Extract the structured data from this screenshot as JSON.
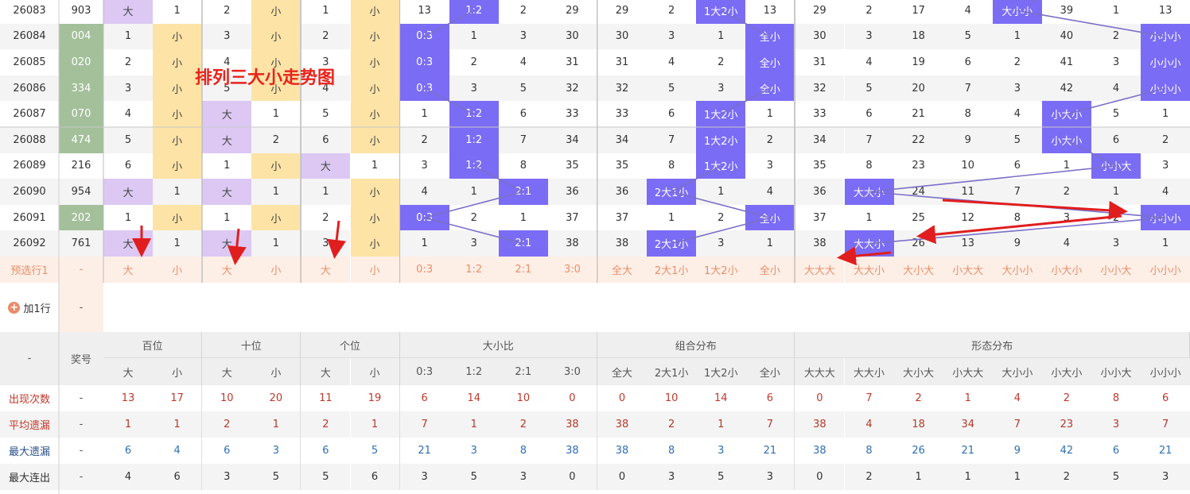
{
  "title_overlay": "排列三大小走势图",
  "header": {
    "blank_label": "-",
    "number_label": "奖号",
    "groups": [
      "百位",
      "十位",
      "个位",
      "大小比",
      "组合分布",
      "形态分布"
    ],
    "sub": [
      "大",
      "小",
      "大",
      "小",
      "大",
      "小",
      "0:3",
      "1:2",
      "2:1",
      "3:0",
      "全大",
      "2大1小",
      "1大2小",
      "全小",
      "大大大",
      "大大小",
      "大小大",
      "小大大",
      "大小小",
      "小大小",
      "小小大",
      "小小小"
    ]
  },
  "rows": [
    {
      "issue": "26083",
      "num": "903",
      "cells": [
        "大",
        "1",
        "2",
        "小",
        "1",
        "小",
        "13",
        "1:2",
        "2",
        "29",
        "29",
        "2",
        "1大2小",
        "13",
        "29",
        "2",
        "17",
        "4",
        "大小小",
        "39",
        "1",
        "13"
      ]
    },
    {
      "issue": "26084",
      "num": "004",
      "cells": [
        "1",
        "小",
        "3",
        "小",
        "2",
        "小",
        "0:3",
        "1",
        "3",
        "30",
        "30",
        "3",
        "1",
        "全小",
        "30",
        "3",
        "18",
        "5",
        "1",
        "40",
        "2",
        "小小小"
      ]
    },
    {
      "issue": "26085",
      "num": "020",
      "cells": [
        "2",
        "小",
        "4",
        "小",
        "3",
        "小",
        "0:3",
        "2",
        "4",
        "31",
        "31",
        "4",
        "2",
        "全小",
        "31",
        "4",
        "19",
        "6",
        "2",
        "41",
        "3",
        "小小小"
      ]
    },
    {
      "issue": "26086",
      "num": "334",
      "cells": [
        "3",
        "小",
        "5",
        "小",
        "4",
        "小",
        "0:3",
        "3",
        "5",
        "32",
        "32",
        "5",
        "3",
        "全小",
        "32",
        "5",
        "20",
        "7",
        "3",
        "42",
        "4",
        "小小小"
      ]
    },
    {
      "issue": "26087",
      "num": "070",
      "cells": [
        "4",
        "小",
        "大",
        "1",
        "5",
        "小",
        "1",
        "1:2",
        "6",
        "33",
        "33",
        "6",
        "1大2小",
        "1",
        "33",
        "6",
        "21",
        "8",
        "4",
        "小大小",
        "5",
        "1"
      ]
    },
    {
      "issue": "26088",
      "num": "474",
      "cells": [
        "5",
        "小",
        "大",
        "2",
        "6",
        "小",
        "2",
        "1:2",
        "7",
        "34",
        "34",
        "7",
        "1大2小",
        "2",
        "34",
        "7",
        "22",
        "9",
        "5",
        "小大小",
        "6",
        "2"
      ]
    },
    {
      "issue": "26089",
      "num": "216",
      "cells": [
        "6",
        "小",
        "1",
        "小",
        "大",
        "1",
        "3",
        "1:2",
        "8",
        "35",
        "35",
        "8",
        "1大2小",
        "3",
        "35",
        "8",
        "23",
        "10",
        "6",
        "1",
        "小小大",
        "3"
      ]
    },
    {
      "issue": "26090",
      "num": "954",
      "cells": [
        "大",
        "1",
        "大",
        "1",
        "1",
        "小",
        "4",
        "1",
        "2:1",
        "36",
        "36",
        "2大1小",
        "1",
        "4",
        "36",
        "大大小",
        "24",
        "11",
        "7",
        "2",
        "1",
        "4"
      ]
    },
    {
      "issue": "26091",
      "num": "202",
      "cells": [
        "1",
        "小",
        "1",
        "小",
        "2",
        "小",
        "0:3",
        "2",
        "1",
        "37",
        "37",
        "1",
        "2",
        "全小",
        "37",
        "1",
        "25",
        "12",
        "8",
        "3",
        "2",
        "小小小"
      ]
    },
    {
      "issue": "26092",
      "num": "761",
      "cells": [
        "大",
        "1",
        "大",
        "1",
        "3",
        "小",
        "1",
        "3",
        "2:1",
        "38",
        "38",
        "2大1小",
        "3",
        "1",
        "38",
        "大大小",
        "26",
        "13",
        "9",
        "4",
        "3",
        "1"
      ]
    }
  ],
  "preselect": {
    "label": "预选行1",
    "num": "-",
    "cells": [
      "大",
      "小",
      "大",
      "小",
      "大",
      "小",
      "0:3",
      "1:2",
      "2:1",
      "3:0",
      "全大",
      "2大1小",
      "1大2小",
      "全小",
      "大大大",
      "大大小",
      "大小大",
      "小大大",
      "大小小",
      "小大小",
      "小小大",
      "小小小"
    ]
  },
  "add_row": {
    "icon": "plus-circle-icon",
    "label": "加1行",
    "num": "-"
  },
  "stats": [
    {
      "label": "出现次数",
      "num": "-",
      "values": [
        "13",
        "17",
        "10",
        "20",
        "11",
        "19",
        "6",
        "14",
        "10",
        "0",
        "0",
        "10",
        "14",
        "6",
        "0",
        "7",
        "2",
        "1",
        "4",
        "2",
        "8",
        "6"
      ]
    },
    {
      "label": "平均遗漏",
      "num": "-",
      "values": [
        "1",
        "1",
        "2",
        "1",
        "2",
        "1",
        "7",
        "1",
        "2",
        "38",
        "38",
        "2",
        "1",
        "7",
        "38",
        "4",
        "18",
        "34",
        "7",
        "23",
        "3",
        "7"
      ]
    },
    {
      "label": "最大遗漏",
      "num": "-",
      "values": [
        "6",
        "4",
        "6",
        "3",
        "6",
        "5",
        "21",
        "3",
        "8",
        "38",
        "38",
        "8",
        "3",
        "21",
        "38",
        "8",
        "26",
        "21",
        "9",
        "42",
        "6",
        "21"
      ]
    },
    {
      "label": "最大连出",
      "num": "-",
      "values": [
        "4",
        "6",
        "3",
        "5",
        "5",
        "6",
        "3",
        "5",
        "3",
        "0",
        "0",
        "3",
        "5",
        "3",
        "0",
        "2",
        "1",
        "1",
        "1",
        "2",
        "5",
        "3"
      ]
    }
  ],
  "colors": {
    "green": "#a3c09a",
    "lavender": "#dcc8f3",
    "yellow": "#fde3a6",
    "purple": "#7b6cf5",
    "pre_bg": "#fdeee6",
    "pre_text": "#e8906a",
    "header_bg": "#efefef",
    "line": "#7a70c8",
    "arrow": "#e01e1e",
    "count_red": "#c0392b",
    "avg_red": "#b23a2b",
    "max_blue": "#2f6fb5",
    "streak_dark": "#333333"
  }
}
